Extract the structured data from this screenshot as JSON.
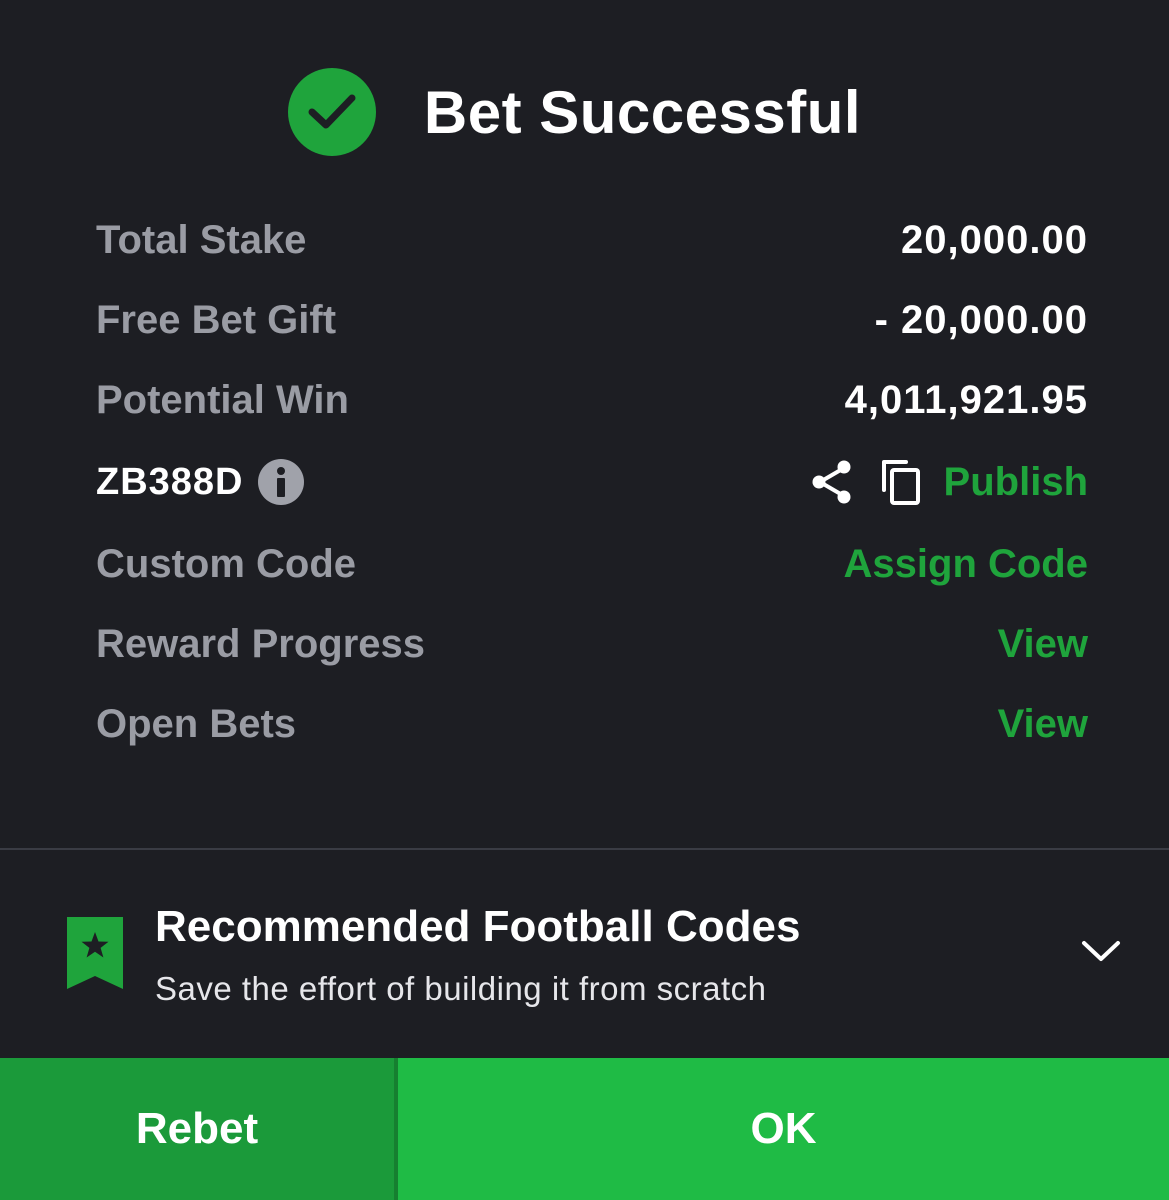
{
  "header": {
    "title": "Bet Successful",
    "icon": "check-circle-icon"
  },
  "summary": {
    "total_stake_label": "Total Stake",
    "total_stake_value": "20,000.00",
    "free_bet_label": "Free Bet Gift",
    "free_bet_value": "- 20,000.00",
    "potential_win_label": "Potential Win",
    "potential_win_value": "4,011,921.95"
  },
  "booking": {
    "code": "ZB388D",
    "publish_label": "Publish"
  },
  "links": {
    "custom_code_label": "Custom Code",
    "assign_code_label": "Assign Code",
    "reward_progress_label": "Reward Progress",
    "reward_view_label": "View",
    "open_bets_label": "Open Bets",
    "open_bets_view_label": "View"
  },
  "recommended": {
    "title": "Recommended Football Codes",
    "subtitle": "Save the effort of building it from scratch"
  },
  "actions": {
    "rebet_label": "Rebet",
    "ok_label": "OK"
  },
  "colors": {
    "background": "#1d1e23",
    "accent_green": "#1fa43c",
    "ok_button": "#1fbb45",
    "rebet_button": "#1b9a3a",
    "label_gray": "#9a9ca4"
  }
}
